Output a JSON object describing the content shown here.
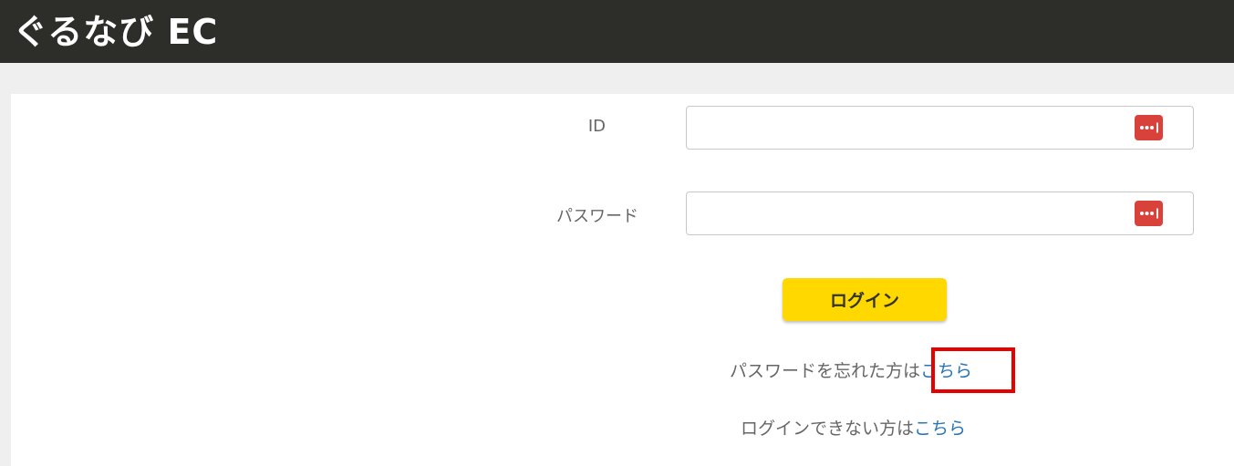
{
  "header": {
    "logo_text": "ぐるなび EC"
  },
  "form": {
    "id_label": "ID",
    "id_value": "",
    "password_label": "パスワード",
    "password_value": "",
    "password_manager_icon": "lastpass-icon",
    "login_button": "ログイン"
  },
  "links": {
    "forgot_password_prefix": "パスワードを忘れた方は",
    "forgot_password_link": "こちら",
    "cannot_login_prefix": "ログインできない方は",
    "cannot_login_link": "こちら"
  },
  "colors": {
    "header_bg": "#2d2d2a",
    "login_button_bg": "#ffd800",
    "link": "#2a75b3",
    "password_manager_icon_bg": "#d9413b",
    "highlight_border": "#e60000"
  }
}
